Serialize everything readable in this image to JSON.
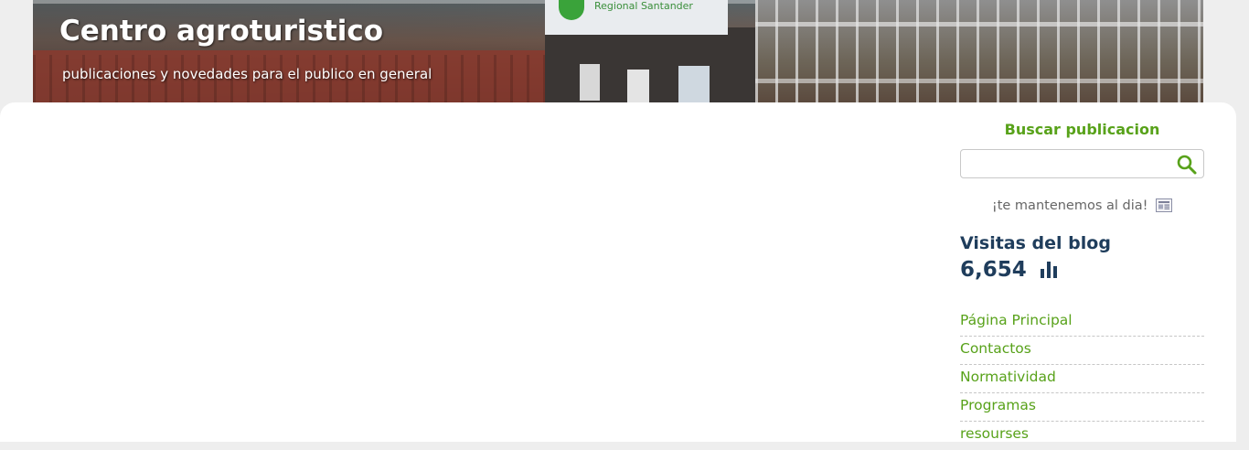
{
  "header": {
    "title": "Centro agroturistico",
    "description": "publicaciones y novedades para el publico en general",
    "banner_sign_text": "Regional Santander"
  },
  "sidebar": {
    "search": {
      "title": "Buscar publicacion",
      "placeholder": "",
      "value": "",
      "button_icon": "search-icon"
    },
    "tagline": "¡te mantenemos al dia!",
    "tagline_icon": "newspaper-icon",
    "stats": {
      "title": "Visitas del blog",
      "count": "6,654",
      "icon": "bar-chart-icon"
    },
    "pages": [
      {
        "label": "Página Principal"
      },
      {
        "label": "Contactos"
      },
      {
        "label": "Normatividad"
      },
      {
        "label": "Programas"
      },
      {
        "label": "resourses"
      }
    ]
  },
  "colors": {
    "accent_green": "#58a21a",
    "stats_blue": "#1f3d5c",
    "page_background": "#eeeeee",
    "content_background": "#ffffff"
  }
}
